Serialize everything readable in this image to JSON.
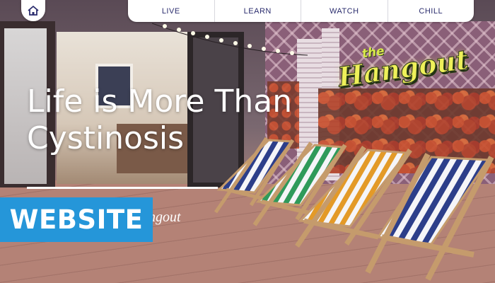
{
  "nav": {
    "home_icon": "home-icon",
    "items": [
      {
        "label": "LIVE"
      },
      {
        "label": "LEARN"
      },
      {
        "label": "WATCH"
      },
      {
        "label": "CHILL"
      }
    ]
  },
  "hero": {
    "headline_line1": "Life is More Than",
    "headline_line2": "Cystinosis",
    "tagline": "angout",
    "sign_small": "the",
    "sign_large": "Hangout"
  },
  "badge": {
    "label": "WEBSITE",
    "color": "#2596d9"
  },
  "colors": {
    "nav_text": "#2b2d6e",
    "sign": "#eef05a"
  }
}
